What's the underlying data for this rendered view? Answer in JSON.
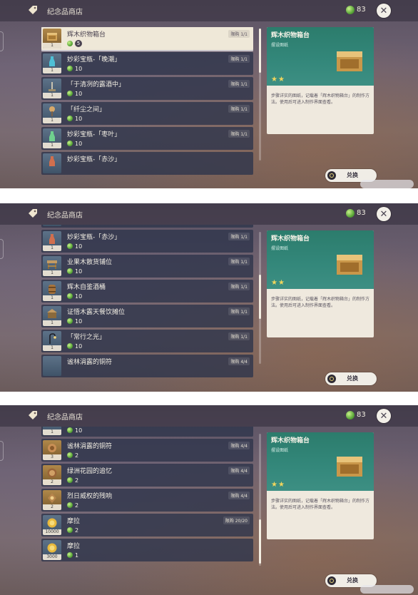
{
  "shop": {
    "title": "纪念品商店",
    "currency": "83"
  },
  "detail": {
    "title": "辉木织物箱台",
    "type": "摆设图纸",
    "stars": "★★",
    "description": "步骤详实的图纸，记载着「辉木织物箱台」的制作方法。使用后可进入制作界面查看。"
  },
  "exchange_label": "兑换",
  "panels": [
    {
      "items": [
        {
          "name": "辉木织物箱台",
          "price": "5",
          "limit": "限购 1/1",
          "qty": "1",
          "selected": true
        },
        {
          "name": "妙彩宝瓶-「晚潮」",
          "price": "10",
          "limit": "限购 1/1",
          "qty": "1"
        },
        {
          "name": "「于清冽的露酒中」",
          "price": "10",
          "limit": "限购 1/1",
          "qty": "1"
        },
        {
          "name": "「纤尘之间」",
          "price": "10",
          "limit": "限购 1/1",
          "qty": "1"
        },
        {
          "name": "妙彩宝瓶-「枣叶」",
          "price": "10",
          "limit": "限购 1/1",
          "qty": "1"
        },
        {
          "name": "妙彩宝瓶-「赤沙」",
          "price": "",
          "limit": "",
          "qty": ""
        }
      ]
    },
    {
      "items": [
        {
          "name": "",
          "price": "",
          "limit": "",
          "qty": ""
        },
        {
          "name": "妙彩宝瓶-「赤沙」",
          "price": "10",
          "limit": "限购 1/1",
          "qty": "1"
        },
        {
          "name": "业果木散货铺位",
          "price": "10",
          "limit": "限购 1/1",
          "qty": "1"
        },
        {
          "name": "辉木自鉴酒桶",
          "price": "10",
          "limit": "限购 1/1",
          "qty": "1"
        },
        {
          "name": "证悟木露天餐饮摊位",
          "price": "10",
          "limit": "限购 1/1",
          "qty": "1"
        },
        {
          "name": "「常行之光」",
          "price": "10",
          "limit": "限购 1/1",
          "qty": "1"
        },
        {
          "name": "谧林涓露的铜符",
          "price": "",
          "limit": "限购 4/4",
          "qty": ""
        }
      ]
    },
    {
      "items": [
        {
          "name": "",
          "price": "10",
          "limit": "",
          "qty": "1"
        },
        {
          "name": "谧林涓露的铜符",
          "price": "2",
          "limit": "限购 4/4",
          "qty": "3"
        },
        {
          "name": "绿洲花园的追忆",
          "price": "2",
          "limit": "限购 4/4",
          "qty": "2"
        },
        {
          "name": "烈日威权的残响",
          "price": "2",
          "limit": "限购 4/4",
          "qty": "2"
        },
        {
          "name": "摩拉",
          "price": "2",
          "limit": "限购 20/20",
          "qty": "10000"
        },
        {
          "name": "摩拉",
          "price": "1",
          "limit": "",
          "qty": "3000"
        }
      ]
    }
  ]
}
